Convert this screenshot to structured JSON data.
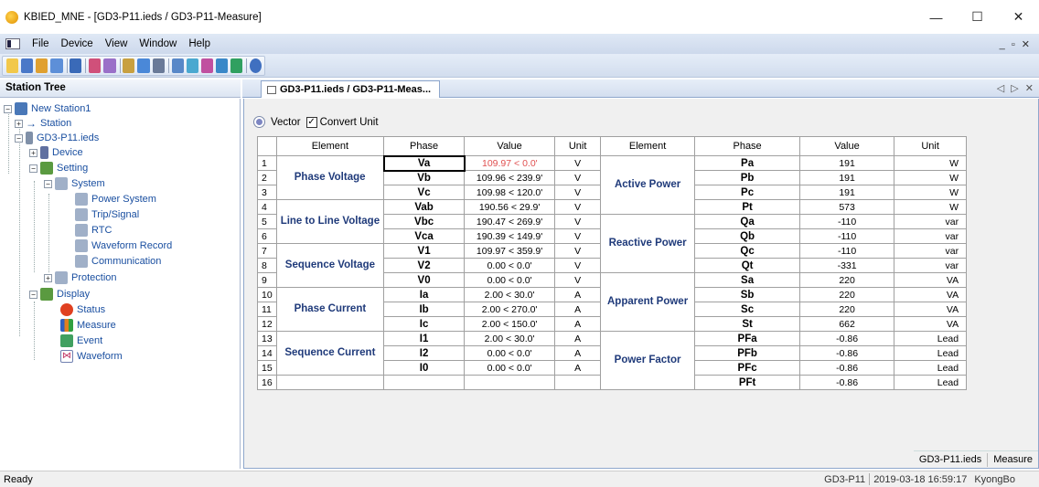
{
  "window": {
    "title": "KBIED_MNE - [GD3-P11.ieds / GD3-P11-Measure]",
    "minimize": "—",
    "maximize": "☐",
    "close": "✕"
  },
  "menu": {
    "items": [
      "File",
      "Device",
      "View",
      "Window",
      "Help"
    ],
    "mdi_controls": "_ ▫ ✕"
  },
  "tree": {
    "header": "Station Tree",
    "nodes": {
      "root": "New Station1",
      "station": "Station",
      "ieds": "GD3-P11.ieds",
      "device": "Device",
      "setting": "Setting",
      "system": "System",
      "power_system": "Power System",
      "trip_signal": "Trip/Signal",
      "rtc": "RTC",
      "waveform_record": "Waveform Record",
      "communication": "Communication",
      "protection": "Protection",
      "display": "Display",
      "status": "Status",
      "measure": "Measure",
      "event": "Event",
      "waveform": "Waveform"
    }
  },
  "tabs": {
    "active": "GD3-P11.ieds / GD3-P11-Meas...",
    "controls": "◁ ▷ ✕"
  },
  "options": {
    "vector_label": "Vector",
    "convert_unit_label": "Convert Unit",
    "convert_unit_checked": "✓"
  },
  "table": {
    "headers": [
      "Element",
      "Phase",
      "Value",
      "Unit",
      "Element",
      "Phase",
      "Value",
      "Unit"
    ],
    "left_groups": [
      "Phase Voltage",
      "Line to Line Voltage",
      "Sequence Voltage",
      "Phase Current",
      "Sequence Current"
    ],
    "right_groups": [
      "Active Power",
      "Reactive Power",
      "Apparent Power",
      "Power Factor"
    ],
    "rows": [
      {
        "n": "1",
        "ph": "Va",
        "val": "109.97 < 0.0'",
        "unit": "V",
        "rph": "Pa",
        "rval": "191",
        "runit": "W"
      },
      {
        "n": "2",
        "ph": "Vb",
        "val": "109.96 < 239.9'",
        "unit": "V",
        "rph": "Pb",
        "rval": "191",
        "runit": "W"
      },
      {
        "n": "3",
        "ph": "Vc",
        "val": "109.98 < 120.0'",
        "unit": "V",
        "rph": "Pc",
        "rval": "191",
        "runit": "W"
      },
      {
        "n": "4",
        "ph": "Vab",
        "val": "190.56 < 29.9'",
        "unit": "V",
        "rph": "Pt",
        "rval": "573",
        "runit": "W"
      },
      {
        "n": "5",
        "ph": "Vbc",
        "val": "190.47 < 269.9'",
        "unit": "V",
        "rph": "Qa",
        "rval": "-110",
        "runit": "var"
      },
      {
        "n": "6",
        "ph": "Vca",
        "val": "190.39 < 149.9'",
        "unit": "V",
        "rph": "Qb",
        "rval": "-110",
        "runit": "var"
      },
      {
        "n": "7",
        "ph": "V1",
        "val": "109.97 < 359.9'",
        "unit": "V",
        "rph": "Qc",
        "rval": "-110",
        "runit": "var"
      },
      {
        "n": "8",
        "ph": "V2",
        "val": "0.00 < 0.0'",
        "unit": "V",
        "rph": "Qt",
        "rval": "-331",
        "runit": "var"
      },
      {
        "n": "9",
        "ph": "V0",
        "val": "0.00 < 0.0'",
        "unit": "V",
        "rph": "Sa",
        "rval": "220",
        "runit": "VA"
      },
      {
        "n": "10",
        "ph": "Ia",
        "val": "2.00 < 30.0'",
        "unit": "A",
        "rph": "Sb",
        "rval": "220",
        "runit": "VA"
      },
      {
        "n": "11",
        "ph": "Ib",
        "val": "2.00 < 270.0'",
        "unit": "A",
        "rph": "Sc",
        "rval": "220",
        "runit": "VA"
      },
      {
        "n": "12",
        "ph": "Ic",
        "val": "2.00 < 150.0'",
        "unit": "A",
        "rph": "St",
        "rval": "662",
        "runit": "VA"
      },
      {
        "n": "13",
        "ph": "I1",
        "val": "2.00 < 30.0'",
        "unit": "A",
        "rph": "PFa",
        "rval": "-0.86",
        "runit": "Lead"
      },
      {
        "n": "14",
        "ph": "I2",
        "val": "0.00 < 0.0'",
        "unit": "A",
        "rph": "PFb",
        "rval": "-0.86",
        "runit": "Lead"
      },
      {
        "n": "15",
        "ph": "I0",
        "val": "0.00 < 0.0'",
        "unit": "A",
        "rph": "PFc",
        "rval": "-0.86",
        "runit": "Lead"
      },
      {
        "n": "16",
        "ph": "",
        "val": "",
        "unit": "",
        "rph": "PFt",
        "rval": "-0.86",
        "runit": "Lead"
      }
    ]
  },
  "bottom_tabs": [
    "GD3-P11.ieds",
    "Measure"
  ],
  "status": {
    "ready": "Ready",
    "device": "GD3-P11",
    "timestamp": "2019-03-18 16:59:17",
    "user": "KyongBo"
  },
  "colors": {
    "highlight_value": "#e05050",
    "group_label": "#1f3a7a",
    "tree_text": "#1a4fa0"
  }
}
